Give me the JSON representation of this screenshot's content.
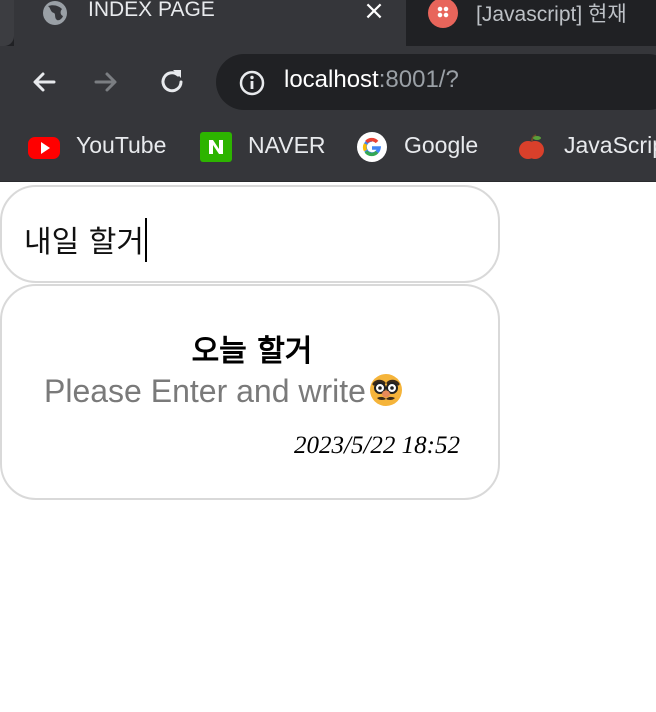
{
  "browser": {
    "tabs": [
      {
        "title": "INDEX PAGE",
        "active": true
      },
      {
        "title": "[Javascript] 현재",
        "active": false
      }
    ],
    "address_bar": {
      "host": "localhost",
      "rest": ":8001/?"
    },
    "bookmarks": [
      {
        "label": "YouTube",
        "icon": "youtube-icon"
      },
      {
        "label": "NAVER",
        "icon": "naver-icon"
      },
      {
        "label": "Google",
        "icon": "google-icon"
      },
      {
        "label": "JavaScrip",
        "icon": "apple-icon"
      }
    ]
  },
  "page": {
    "input_value": "내일 할거",
    "todo": {
      "title": "오늘 할거",
      "content": "Please Enter and write",
      "emoji": "disguised-face-icon",
      "timestamp": "2023/5/22 18:52"
    }
  },
  "colors": {
    "tabstrip": "#202124",
    "toolbar": "#35363a",
    "card_border": "#d9d9d9",
    "placeholder_text": "#7a7a7a"
  }
}
